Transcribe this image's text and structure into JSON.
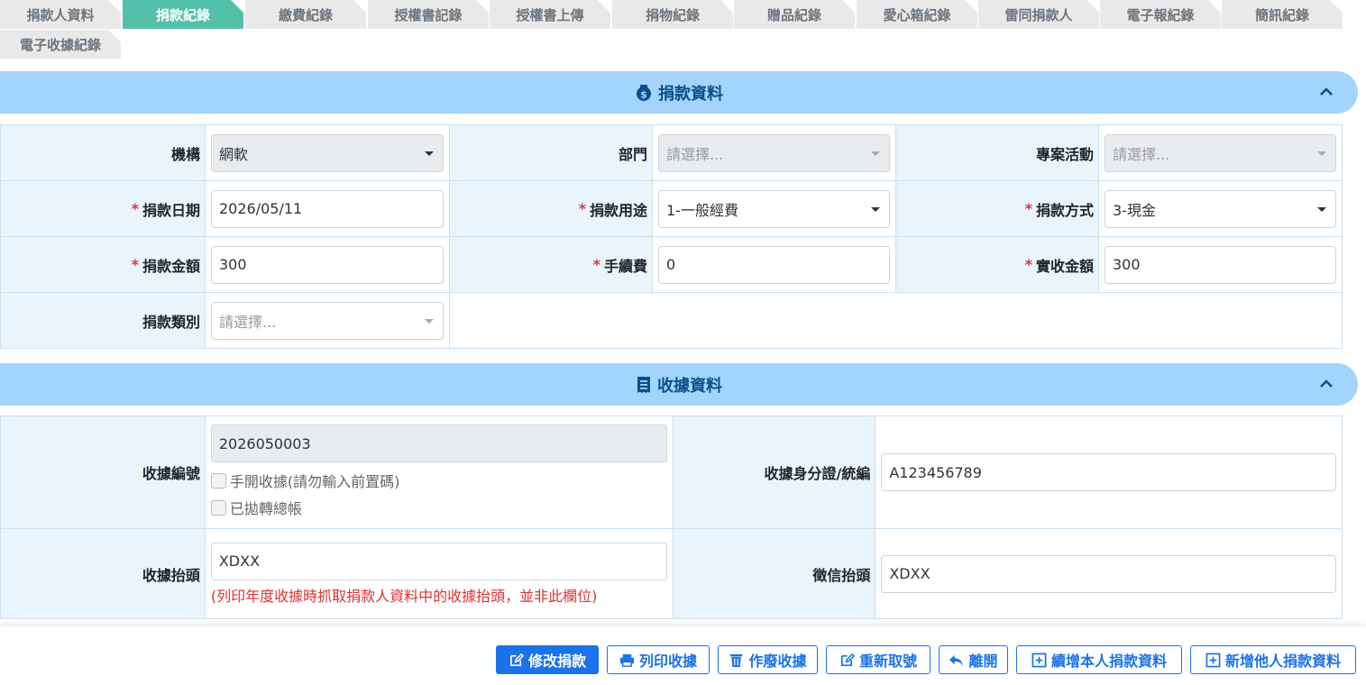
{
  "tabs": [
    {
      "label": "捐款人資料",
      "active": false
    },
    {
      "label": "捐款紀錄",
      "active": true
    },
    {
      "label": "繳費紀錄",
      "active": false
    },
    {
      "label": "授權書記錄",
      "active": false
    },
    {
      "label": "授權書上傳",
      "active": false
    },
    {
      "label": "捐物紀錄",
      "active": false
    },
    {
      "label": "贈品紀錄",
      "active": false
    },
    {
      "label": "愛心箱紀錄",
      "active": false
    },
    {
      "label": "雷同捐款人",
      "active": false
    },
    {
      "label": "電子報紀錄",
      "active": false
    },
    {
      "label": "簡訊紀錄",
      "active": false
    },
    {
      "label": "電子收據紀錄",
      "active": false
    }
  ],
  "donation": {
    "title": "捐款資料",
    "org_label": "機構",
    "org_value": "網軟",
    "dept_label": "部門",
    "dept_placeholder": "請選擇...",
    "project_label": "專案活動",
    "project_placeholder": "請選擇...",
    "date_label": "捐款日期",
    "date_value": "2026/05/11",
    "purpose_label": "捐款用途",
    "purpose_value": "1-一般經費",
    "method_label": "捐款方式",
    "method_value": "3-現金",
    "amount_label": "捐款金額",
    "amount_value": "300",
    "fee_label": "手續費",
    "fee_value": "0",
    "received_label": "實收金額",
    "received_value": "300",
    "category_label": "捐款類別",
    "category_placeholder": "請選擇..."
  },
  "receipt": {
    "title": "收據資料",
    "number_label": "收據編號",
    "number_value": "2026050003",
    "manual_label": "手開收據(請勿輸入前置碼)",
    "transferred_label": "已拋轉總帳",
    "id_label": "收據身分證/統編",
    "id_value": "A123456789",
    "header_label": "收據抬頭",
    "header_value": "XDXX",
    "header_note": "(列印年度收據時抓取捐款人資料中的收據抬頭，並非此欄位)",
    "letter_label": "徵信抬頭",
    "letter_value": "XDXX"
  },
  "toolbar": {
    "edit": "修改捐款",
    "print": "列印收據",
    "void": "作廢收據",
    "renumber": "重新取號",
    "leave": "離開",
    "add_self": "續增本人捐款資料",
    "add_other": "新增他人捐款資料"
  },
  "colors": {
    "accent": "#1a73e8",
    "tab_active": "#53c1a9",
    "section_header": "#a3d4fb",
    "required": "#dc3545"
  }
}
